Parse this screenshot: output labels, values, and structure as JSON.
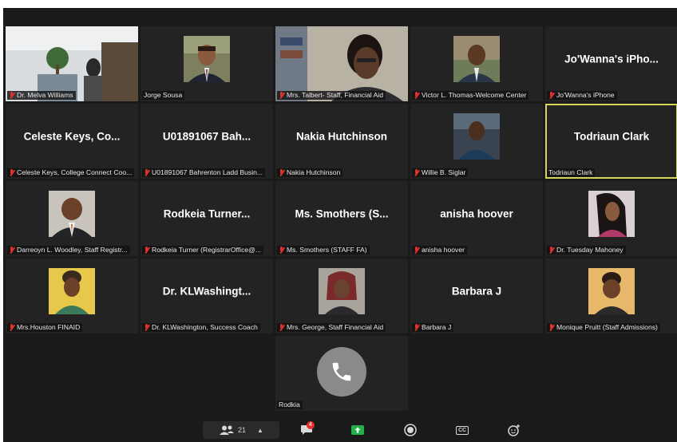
{
  "colors": {
    "background": "#1a1a1a",
    "tile": "#232323",
    "speaker_outline": "#d6d65a",
    "muted_icon": "#e0312b",
    "share_button": "#22b04a"
  },
  "tiles": [
    {
      "name": "Dr. Melva Williams",
      "display": "",
      "muted": true
    },
    {
      "name": "Jorge Sousa",
      "display": "",
      "muted": false
    },
    {
      "name": "Mrs. Talbert- Staff, Financial Aid",
      "display": "",
      "muted": true
    },
    {
      "name": "Victor L. Thomas-Welcome Center",
      "display": "",
      "muted": true
    },
    {
      "name": "Jo'Wanna's iPhone",
      "display": "Jo'Wanna's iPho...",
      "muted": true
    },
    {
      "name": "Celeste Keys, College Connect Coo...",
      "display": "Celeste Keys, Co...",
      "muted": true
    },
    {
      "name": "U01891067 Bahrenton Ladd Busin...",
      "display": "U01891067 Bah...",
      "muted": true
    },
    {
      "name": "Nakia Hutchinson",
      "display": "Nakia Hutchinson",
      "muted": true
    },
    {
      "name": "Willie B. Siglar",
      "display": "",
      "muted": true
    },
    {
      "name": "Todriaun Clark",
      "display": "Todriaun Clark",
      "muted": false
    },
    {
      "name": "Darreoyn L. Woodley, Staff Registr...",
      "display": "",
      "muted": true
    },
    {
      "name": "Rodkeia Turner (RegistrarOffice@...",
      "display": "Rodkeia Turner...",
      "muted": true
    },
    {
      "name": "Ms. Smothers (STAFF FA)",
      "display": "Ms. Smothers (S...",
      "muted": true
    },
    {
      "name": "anisha hoover",
      "display": "anisha hoover",
      "muted": true
    },
    {
      "name": "Dr. Tuesday Mahoney",
      "display": "",
      "muted": true
    },
    {
      "name": "Mrs.Houston  FINAID",
      "display": "",
      "muted": true
    },
    {
      "name": "Dr. KLWashington, Success Coach",
      "display": "Dr. KLWashingt...",
      "muted": true
    },
    {
      "name": "Mrs. George, Staff Financial Aid",
      "display": "",
      "muted": true
    },
    {
      "name": "Barbara J",
      "display": "Barbara J",
      "muted": true
    },
    {
      "name": "Monique Pruitt (Staff Admissions)",
      "display": "",
      "muted": true
    },
    {
      "name": "Rodkia",
      "display": "",
      "muted": false
    }
  ],
  "toolbar": {
    "participants_count": "21",
    "chat_badge": "4",
    "cc_label": "CC"
  }
}
